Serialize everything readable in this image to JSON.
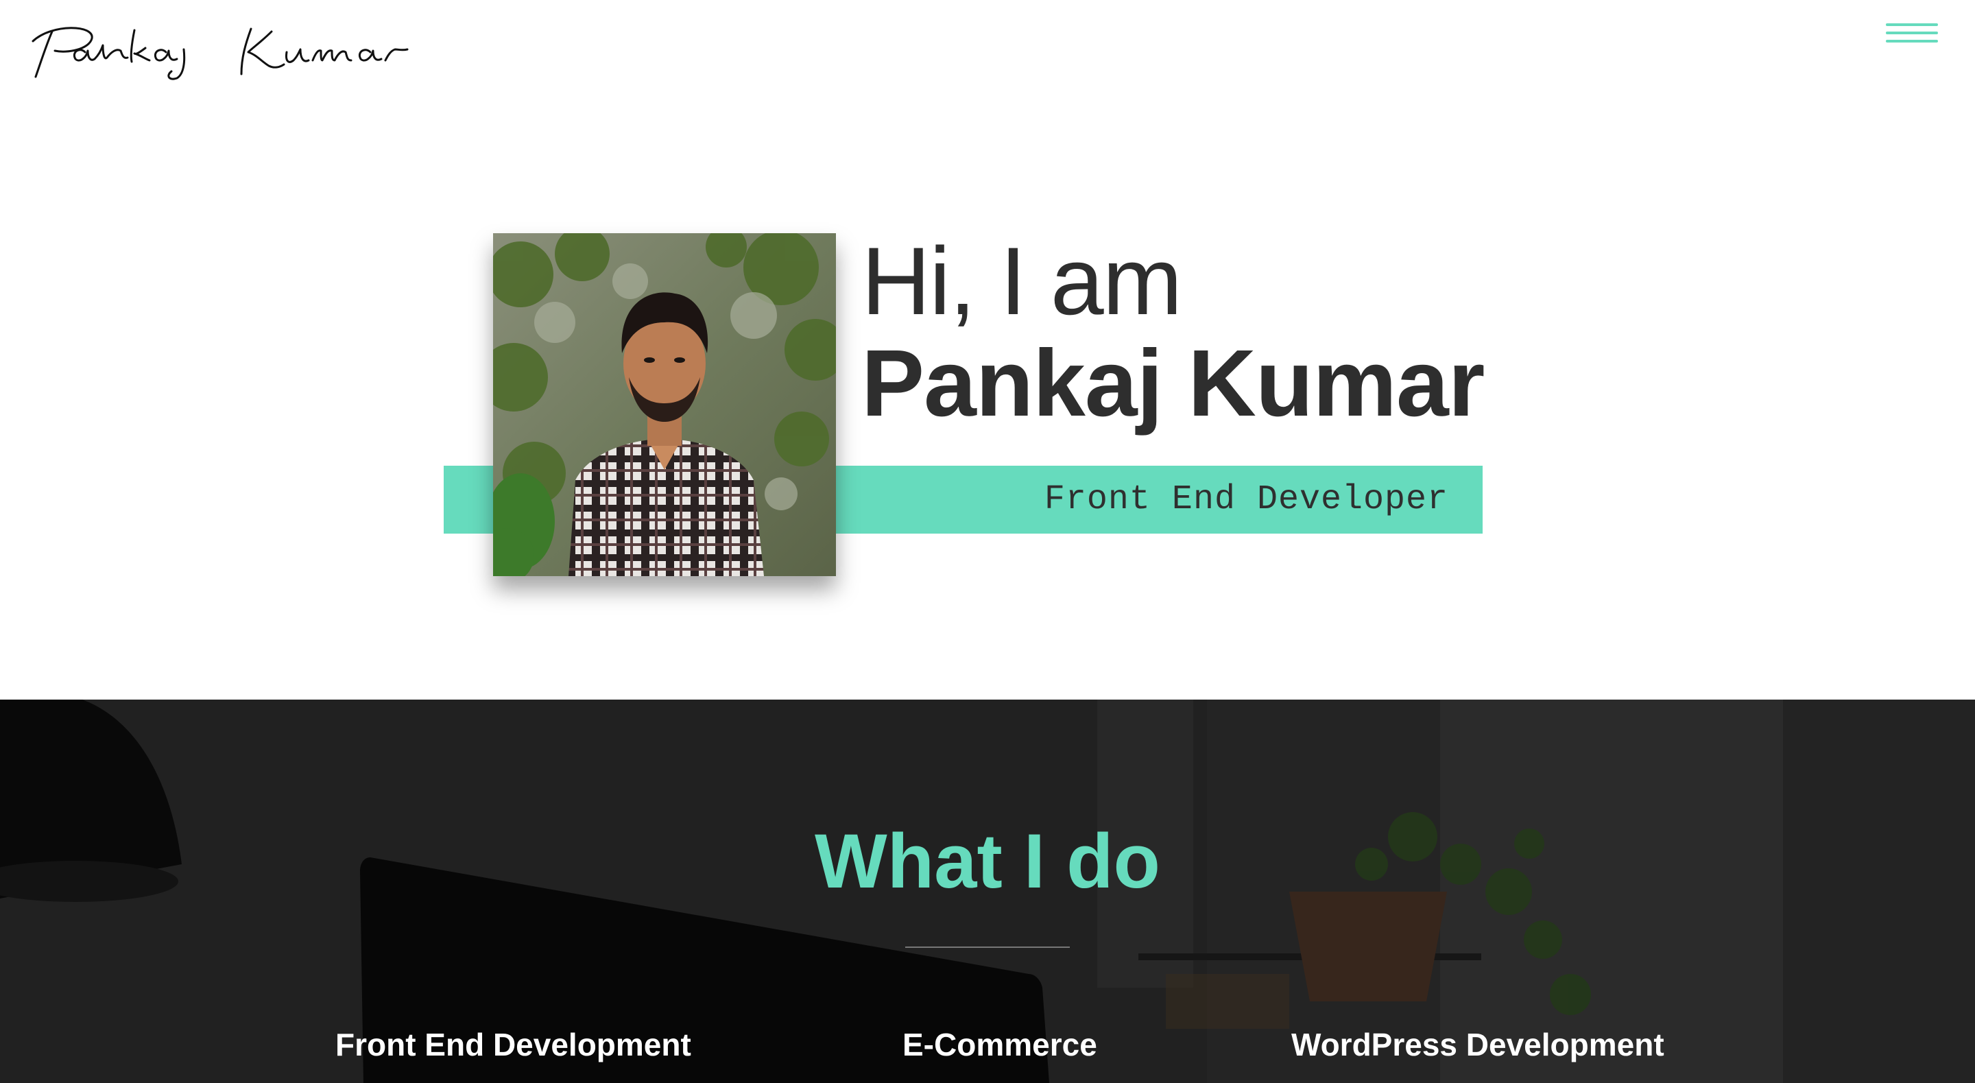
{
  "header": {
    "logo_text": "Pankaj Kumar",
    "menu_icon": "hamburger-menu-icon"
  },
  "hero": {
    "greeting": "Hi, I am",
    "name": "Pankaj Kumar",
    "role": "Front End Developer",
    "portrait": "person-portrait-photo"
  },
  "what_i_do": {
    "title": "What I do",
    "services": [
      {
        "label": "Front End Development"
      },
      {
        "label": "E-Commerce"
      },
      {
        "label": "WordPress Development"
      }
    ]
  },
  "colors": {
    "accent": "#66dbbd",
    "dark_text": "#2e2e2e",
    "section_bg": "#2b2b2b",
    "white": "#ffffff"
  }
}
